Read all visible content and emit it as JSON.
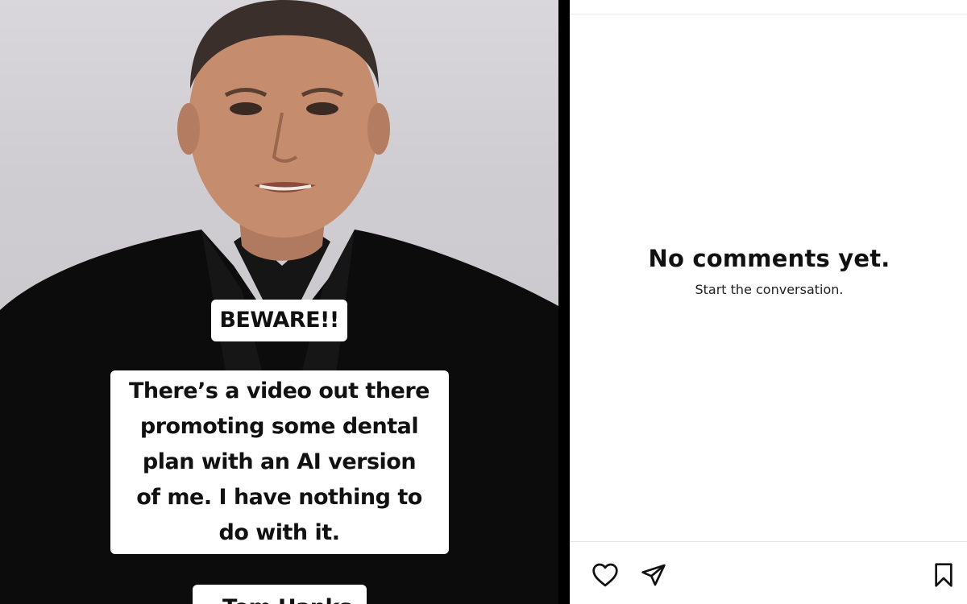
{
  "post": {
    "story_overlay": {
      "beware": "BEWARE!!",
      "message_lines": [
        "There’s a video out there",
        "promoting some dental",
        "plan with an AI version",
        "of me.  I have nothing to",
        "do with it."
      ],
      "signoff": "- Tom Hanks"
    }
  },
  "comments": {
    "empty_title": "No comments yet.",
    "empty_subtitle": "Start the conversation."
  },
  "actions": {
    "like_icon": "heart-icon",
    "share_icon": "paper-plane-icon",
    "save_icon": "bookmark-icon"
  }
}
